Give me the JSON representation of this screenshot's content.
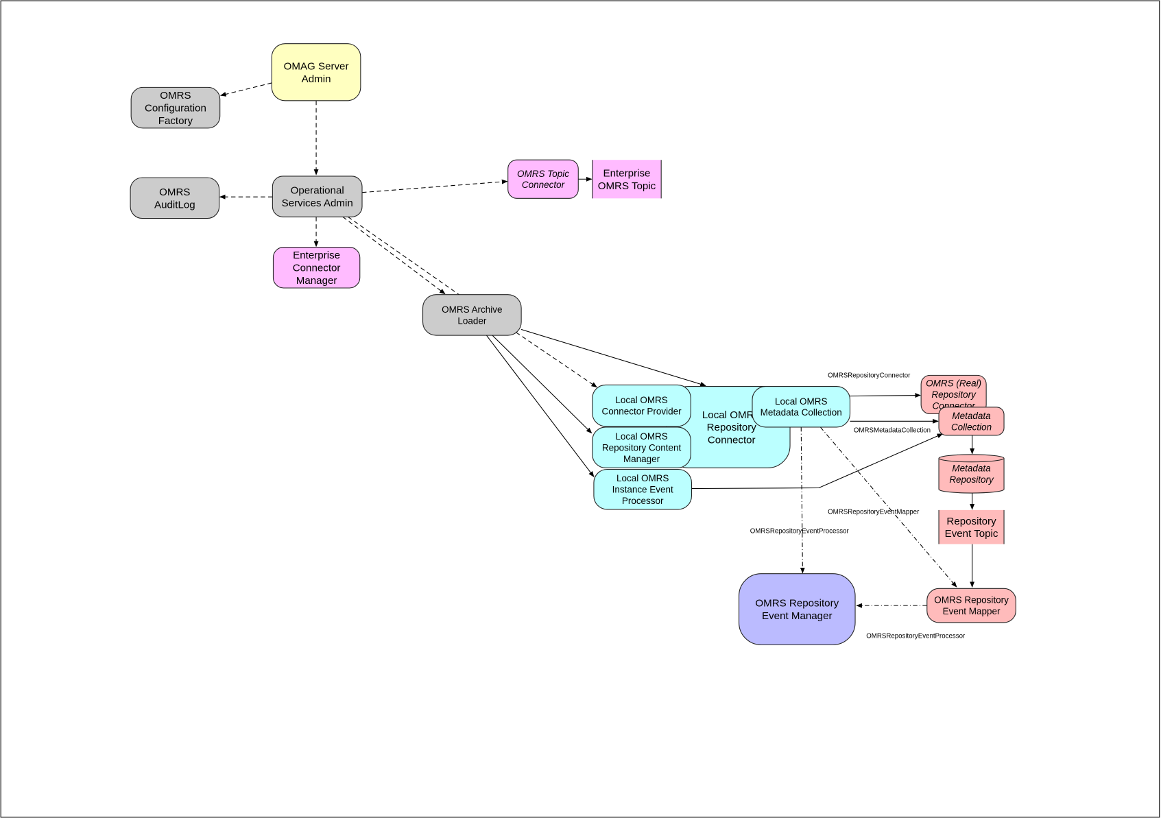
{
  "colors": {
    "admin": "#ffffc0",
    "gray": "#cccccc",
    "pink": "#ffbbff",
    "cyan": "#bbffff",
    "salmon": "#ffbbbb",
    "lavender": "#bbbbff"
  },
  "nodes": {
    "omag_server_admin": {
      "lines": [
        "OMAG Server",
        "Admin"
      ]
    },
    "omrs_configuration_factory": {
      "lines": [
        "OMRS",
        "Configuration",
        "Factory"
      ]
    },
    "operational_services_admin": {
      "lines": [
        "Operational",
        "Services Admin"
      ]
    },
    "omrs_auditlog": {
      "lines": [
        "OMRS",
        "AuditLog"
      ]
    },
    "enterprise_connector_manager": {
      "lines": [
        "Enterprise",
        "Connector",
        "Manager"
      ]
    },
    "omrs_topic_connector": {
      "lines": [
        "OMRS Topic",
        "Connector"
      ]
    },
    "enterprise_omrs_topic": {
      "lines": [
        "Enterprise",
        "OMRS Topic"
      ]
    },
    "omrs_archive_loader": {
      "lines": [
        "OMRS Archive",
        "Loader"
      ]
    },
    "local_omrs_repository_connector": {
      "lines": [
        "Local OMRS",
        "Repository",
        "Connector"
      ]
    },
    "local_omrs_connector_provider": {
      "lines": [
        "Local OMRS",
        "Connector Provider"
      ]
    },
    "local_omrs_repository_content_manager": {
      "lines": [
        "Local OMRS",
        "Repository Content",
        "Manager"
      ]
    },
    "local_omrs_instance_event_processor": {
      "lines": [
        "Local OMRS",
        "Instance Event",
        "Processor"
      ]
    },
    "local_omrs_metadata_collection": {
      "lines": [
        "Local OMRS",
        "Metadata Collection"
      ]
    },
    "omrs_real_repository_connector": {
      "lines": [
        "OMRS (Real)",
        "Repository",
        "Connector"
      ]
    },
    "metadata_collection": {
      "lines": [
        "Metadata",
        "Collection"
      ]
    },
    "metadata_repository": {
      "lines": [
        "Metadata",
        "Repository"
      ]
    },
    "repository_event_topic": {
      "lines": [
        "Repository",
        "Event Topic"
      ]
    },
    "omrs_repository_event_mapper": {
      "lines": [
        "OMRS Repository",
        "Event Mapper"
      ]
    },
    "omrs_repository_event_manager": {
      "lines": [
        "OMRS Repository",
        "Event Manager"
      ]
    }
  },
  "edge_labels": {
    "repository_connector": "OMRSRepositoryConnector",
    "metadata_collection": "OMRSMetadataCollection",
    "repository_event_mapper": "OMRSRepositoryEventMapper",
    "repository_event_processor_1": "OMRSRepositoryEventProcessor",
    "repository_event_processor_2": "OMRSRepositoryEventProcessor"
  }
}
